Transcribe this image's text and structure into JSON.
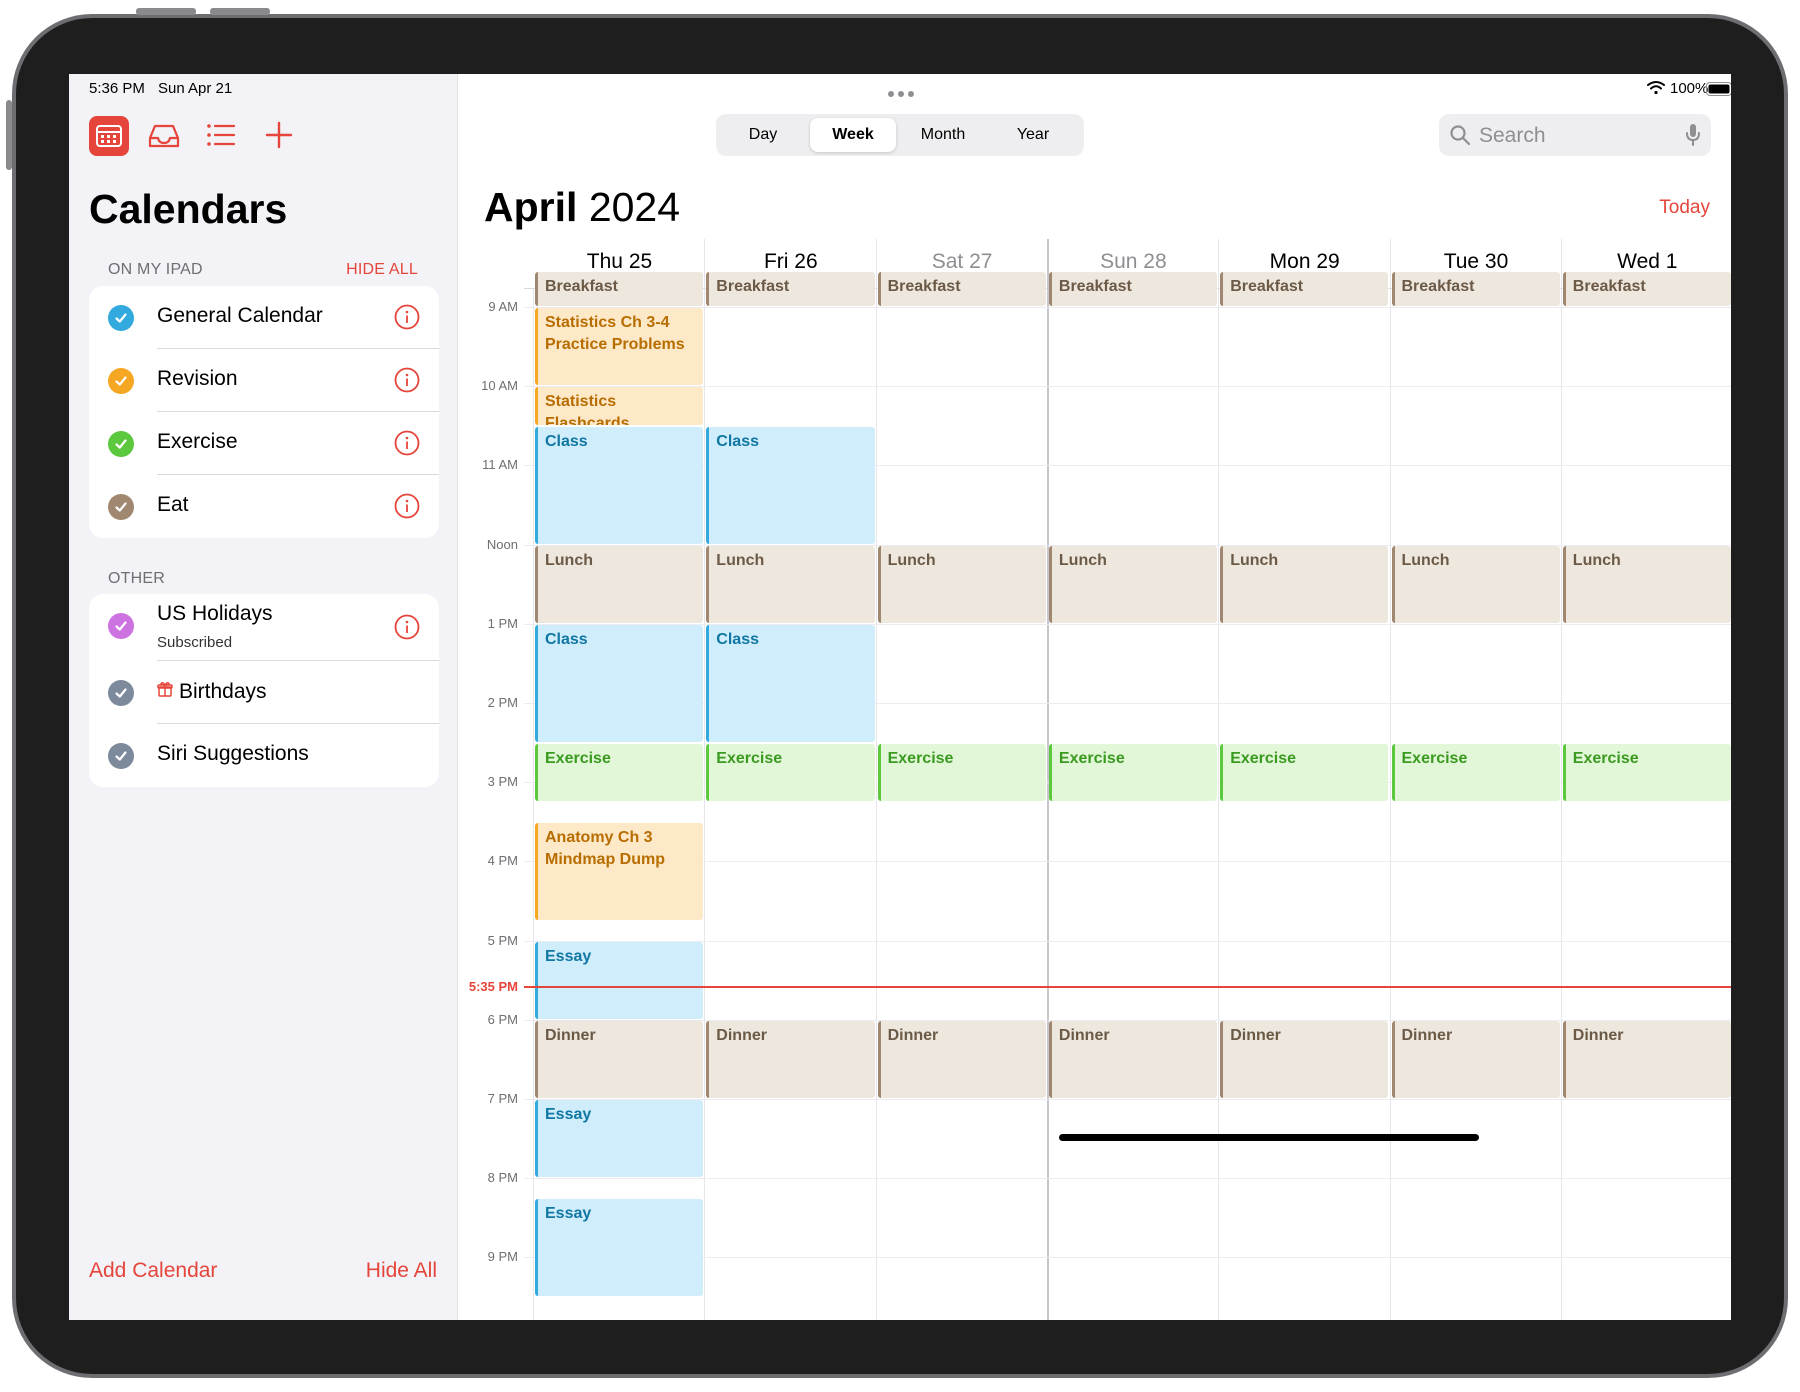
{
  "status": {
    "time": "5:36 PM",
    "date": "Sun Apr 21",
    "battery": "100%"
  },
  "sidebar": {
    "title": "Calendars",
    "section_ipad": "ON MY IPAD",
    "hide_all_header": "HIDE ALL",
    "calendars_ipad": [
      {
        "name": "General Calendar",
        "color": "#32aade"
      },
      {
        "name": "Revision",
        "color": "#f5a623"
      },
      {
        "name": "Exercise",
        "color": "#5cc83d"
      },
      {
        "name": "Eat",
        "color": "#a08870"
      }
    ],
    "section_other": "OTHER",
    "calendars_other": [
      {
        "name": "US Holidays",
        "subtitle": "Subscribed",
        "color": "#cc73e1"
      },
      {
        "name": "Birthdays",
        "color": "#7c8a9c"
      },
      {
        "name": "Siri Suggestions",
        "color": "#7c8a9c"
      }
    ],
    "add_calendar": "Add Calendar",
    "hide_all_footer": "Hide All"
  },
  "toolbar": {
    "views": [
      "Day",
      "Week",
      "Month",
      "Year"
    ],
    "active_view": "Week",
    "search_placeholder": "Search"
  },
  "main": {
    "month": "April",
    "year": "2024",
    "today": "Today",
    "days": [
      {
        "label": "Thu 25",
        "weekend": false
      },
      {
        "label": "Fri 26",
        "weekend": false
      },
      {
        "label": "Sat 27",
        "weekend": true
      },
      {
        "label": "Sun 28",
        "weekend": true
      },
      {
        "label": "Mon 29",
        "weekend": false
      },
      {
        "label": "Tue 30",
        "weekend": false
      },
      {
        "label": "Wed 1",
        "weekend": false
      }
    ],
    "hours": [
      "9 AM",
      "10 AM",
      "11 AM",
      "Noon",
      "1 PM",
      "2 PM",
      "3 PM",
      "4 PM",
      "5 PM",
      "6 PM",
      "7 PM",
      "8 PM",
      "9 PM"
    ],
    "now_label": "5:35 PM",
    "events": [
      {
        "day": 0,
        "start": 8.55,
        "end": 9.0,
        "title": "Breakfast",
        "cal": "eat"
      },
      {
        "day": 1,
        "start": 8.55,
        "end": 9.0,
        "title": "Breakfast",
        "cal": "eat"
      },
      {
        "day": 2,
        "start": 8.55,
        "end": 9.0,
        "title": "Breakfast",
        "cal": "eat"
      },
      {
        "day": 3,
        "start": 8.55,
        "end": 9.0,
        "title": "Breakfast",
        "cal": "eat"
      },
      {
        "day": 4,
        "start": 8.55,
        "end": 9.0,
        "title": "Breakfast",
        "cal": "eat"
      },
      {
        "day": 5,
        "start": 8.55,
        "end": 9.0,
        "title": "Breakfast",
        "cal": "eat"
      },
      {
        "day": 6,
        "start": 8.55,
        "end": 9.0,
        "title": "Breakfast",
        "cal": "eat"
      },
      {
        "day": 0,
        "start": 9.0,
        "end": 10.0,
        "title": "Statistics Ch 3-4 Practice Problems",
        "cal": "rev"
      },
      {
        "day": 0,
        "start": 10.0,
        "end": 10.5,
        "title": "Statistics Flashcards",
        "cal": "rev"
      },
      {
        "day": 0,
        "start": 10.5,
        "end": 12.0,
        "title": "Class",
        "cal": "gen"
      },
      {
        "day": 1,
        "start": 10.5,
        "end": 12.0,
        "title": "Class",
        "cal": "gen"
      },
      {
        "day": 0,
        "start": 12.0,
        "end": 13.0,
        "title": "Lunch",
        "cal": "eat"
      },
      {
        "day": 1,
        "start": 12.0,
        "end": 13.0,
        "title": "Lunch",
        "cal": "eat"
      },
      {
        "day": 2,
        "start": 12.0,
        "end": 13.0,
        "title": "Lunch",
        "cal": "eat"
      },
      {
        "day": 3,
        "start": 12.0,
        "end": 13.0,
        "title": "Lunch",
        "cal": "eat"
      },
      {
        "day": 4,
        "start": 12.0,
        "end": 13.0,
        "title": "Lunch",
        "cal": "eat"
      },
      {
        "day": 5,
        "start": 12.0,
        "end": 13.0,
        "title": "Lunch",
        "cal": "eat"
      },
      {
        "day": 6,
        "start": 12.0,
        "end": 13.0,
        "title": "Lunch",
        "cal": "eat"
      },
      {
        "day": 0,
        "start": 13.0,
        "end": 14.5,
        "title": "Class",
        "cal": "gen"
      },
      {
        "day": 1,
        "start": 13.0,
        "end": 14.5,
        "title": "Class",
        "cal": "gen"
      },
      {
        "day": 0,
        "start": 14.5,
        "end": 15.25,
        "title": "Exercise",
        "cal": "ex"
      },
      {
        "day": 1,
        "start": 14.5,
        "end": 15.25,
        "title": "Exercise",
        "cal": "ex"
      },
      {
        "day": 2,
        "start": 14.5,
        "end": 15.25,
        "title": "Exercise",
        "cal": "ex"
      },
      {
        "day": 3,
        "start": 14.5,
        "end": 15.25,
        "title": "Exercise",
        "cal": "ex"
      },
      {
        "day": 4,
        "start": 14.5,
        "end": 15.25,
        "title": "Exercise",
        "cal": "ex"
      },
      {
        "day": 5,
        "start": 14.5,
        "end": 15.25,
        "title": "Exercise",
        "cal": "ex"
      },
      {
        "day": 6,
        "start": 14.5,
        "end": 15.25,
        "title": "Exercise",
        "cal": "ex"
      },
      {
        "day": 0,
        "start": 15.5,
        "end": 16.75,
        "title": "Anatomy Ch 3 Mindmap Dump",
        "cal": "rev"
      },
      {
        "day": 0,
        "start": 17.0,
        "end": 18.0,
        "title": "Essay",
        "cal": "gen"
      },
      {
        "day": 0,
        "start": 18.0,
        "end": 19.0,
        "title": "Dinner",
        "cal": "eat"
      },
      {
        "day": 1,
        "start": 18.0,
        "end": 19.0,
        "title": "Dinner",
        "cal": "eat"
      },
      {
        "day": 2,
        "start": 18.0,
        "end": 19.0,
        "title": "Dinner",
        "cal": "eat"
      },
      {
        "day": 3,
        "start": 18.0,
        "end": 19.0,
        "title": "Dinner",
        "cal": "eat"
      },
      {
        "day": 4,
        "start": 18.0,
        "end": 19.0,
        "title": "Dinner",
        "cal": "eat"
      },
      {
        "day": 5,
        "start": 18.0,
        "end": 19.0,
        "title": "Dinner",
        "cal": "eat"
      },
      {
        "day": 6,
        "start": 18.0,
        "end": 19.0,
        "title": "Dinner",
        "cal": "eat"
      },
      {
        "day": 0,
        "start": 19.0,
        "end": 20.0,
        "title": "Essay",
        "cal": "gen"
      },
      {
        "day": 0,
        "start": 20.25,
        "end": 21.5,
        "title": "Essay",
        "cal": "gen"
      }
    ]
  },
  "colors": {
    "accent": "#e5453a",
    "eat": "#a08870",
    "revision": "#f5a623",
    "general": "#32aade",
    "exercise": "#5cc83d"
  },
  "icons": [
    "calendar-icon",
    "inbox-icon",
    "list-icon",
    "plus-icon",
    "info-icon",
    "search-icon",
    "microphone-icon",
    "wifi-icon",
    "battery-icon",
    "gift-icon"
  ]
}
